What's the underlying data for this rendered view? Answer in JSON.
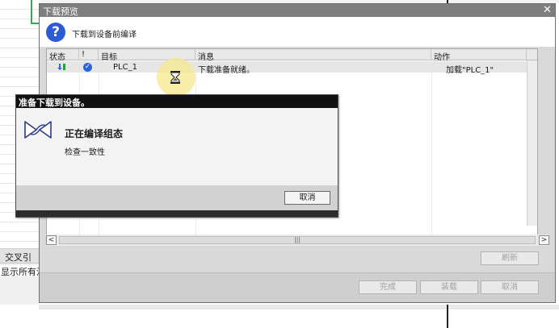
{
  "background": {
    "cross_ref_tab": "交叉引用",
    "cross_ref_text": "显示所有涵"
  },
  "dialog": {
    "title": "下载预览",
    "close_symbol": "✕",
    "heading": "下载到设备前编译",
    "columns": {
      "status": "状态",
      "flag": "!",
      "target": "目标",
      "message": "消息",
      "action": "动作"
    },
    "rows": [
      {
        "target": "PLC_1",
        "message": "下载准备就绪。",
        "action": "加载\"PLC_1\""
      }
    ],
    "buttons": {
      "refresh": "刷新",
      "finish": "完成",
      "load": "装载",
      "cancel": "取消"
    },
    "scroll_left": "<",
    "scroll_right": ">",
    "scroll_thumb": "|||"
  },
  "progress": {
    "title": "准备下载到设备。",
    "heading": "正在编译组态",
    "subtext": "检查一致性",
    "cancel": "取消"
  },
  "colors": {
    "accent_blue": "#2c5bd6",
    "title_dark": "#111111",
    "dialog_gray": "#d9d9d9"
  }
}
